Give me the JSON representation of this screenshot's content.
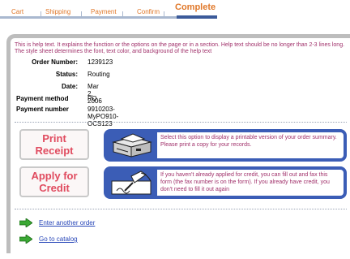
{
  "steps": [
    {
      "label": "Cart"
    },
    {
      "label": "Shipping"
    },
    {
      "label": "Payment"
    },
    {
      "label": "Confirm"
    },
    {
      "label": "Complete"
    }
  ],
  "help_text": "This is help text. It explains the function or the options on the page or in a section. Help text should be no longer than 2-3 lines long. The style sheet determines the font, text color, and background of the help text",
  "order": {
    "number_label": "Order Number:",
    "number": "1239123",
    "status_label": "Status:",
    "status": "Routing",
    "date_label": "Date:",
    "date": "Mar 2, 2006",
    "payment_method_label": "Payment method",
    "payment_method": "PO",
    "payment_number_label": "Payment number",
    "payment_number": "9910203-MyPO910-OCS123"
  },
  "actions": {
    "print": {
      "line1": "Print",
      "line2": "Receipt",
      "description": "Select this option to display a printable version of your order summary. Please print a copy for your records."
    },
    "credit": {
      "line1": "Apply for",
      "line2": "Credit",
      "description": "If you haven't already applied for credit, you can fill out and fax this form (the fax number is on the form). If you already have credit, you don't need to fill it out again"
    }
  },
  "links": {
    "another_order": "Enter another order",
    "catalog": "Go to catalog"
  },
  "colors": {
    "step_text": "#e0782a",
    "help_text": "#a0306a",
    "button_text": "#e04b5f",
    "desc_box": "#3b5db6",
    "link": "#2746b8",
    "arrow": "#3aa834"
  }
}
